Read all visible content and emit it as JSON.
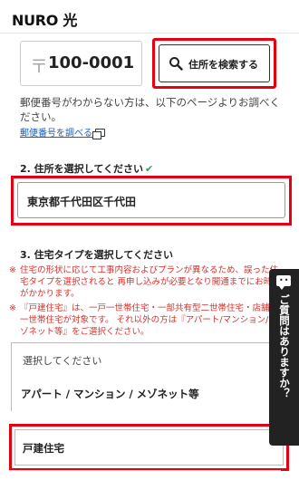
{
  "header": {
    "logo": "NURO 光"
  },
  "zip": {
    "mark": "〒",
    "value": "100-0001"
  },
  "search_button": {
    "label": "住所を検索する",
    "icon": "search-icon"
  },
  "hint": {
    "text": "郵便番号がわからない方は、以下のページよりお調べください。",
    "link": "郵便番号を調べる"
  },
  "section2": {
    "title": "2. 住所を選択してください",
    "check": "✔",
    "address": "東京都千代田区千代田"
  },
  "section3": {
    "title": "3. 住宅タイプを選択してください",
    "notes": [
      {
        "mark": "※",
        "text": "住宅の形状に応じて工事内容およびプランが異なるため、誤った住宅タイプを選択されると 再申し込みが必要となり開通までにお時間がかかります。"
      },
      {
        "mark": "※",
        "text": "『戸建住宅』は、一戸一世帯住宅・一部共有型二世帯住宅・店舗兼一世帯住宅が対象です。 それ以外の方は『アパート/マンション/メゾネット等』をご選択ください。"
      }
    ],
    "select_placeholder": "選択してください",
    "options": [
      "アパート / マンション / メゾネット等",
      "戸建住宅"
    ]
  },
  "chat": {
    "label": "ご質問はありますか？",
    "dots": "•••"
  },
  "colors": {
    "highlight": "#e60012",
    "check": "#2ba24c",
    "note": "#d9302b",
    "link": "#1a5fb4"
  }
}
